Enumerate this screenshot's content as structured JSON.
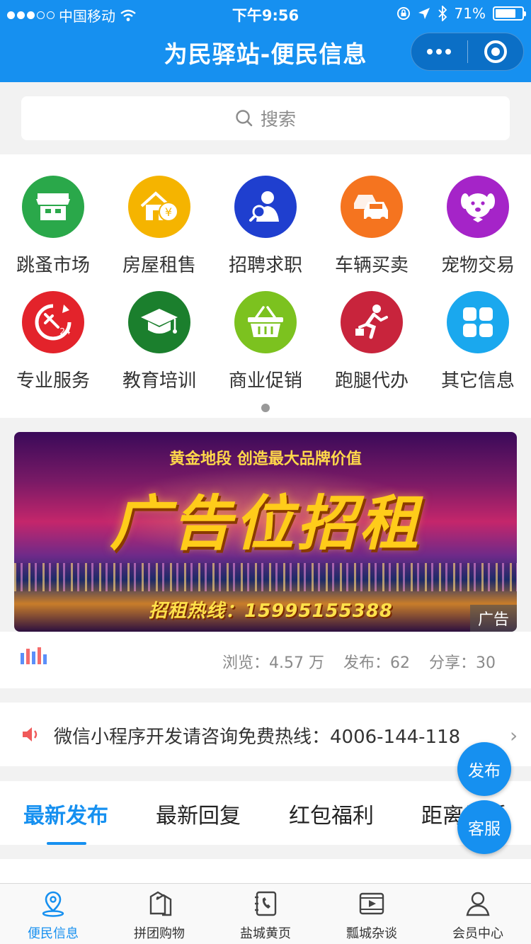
{
  "status_bar": {
    "carrier": "中国移动",
    "time": "下午9:56",
    "battery_percent": "71%",
    "battery_level": 0.71,
    "signal_dots_filled": 3,
    "signal_dots_total": 5
  },
  "header": {
    "title": "为民驿站-便民信息",
    "color": "#1690f0"
  },
  "search": {
    "placeholder": "搜索"
  },
  "categories": [
    {
      "label": "跳蚤市场",
      "color": "#2aa84a",
      "icon": "market-stall-icon"
    },
    {
      "label": "房屋租售",
      "color": "#f5b400",
      "icon": "house-price-icon"
    },
    {
      "label": "招聘求职",
      "color": "#1f3fcf",
      "icon": "job-search-icon"
    },
    {
      "label": "车辆买卖",
      "color": "#f5741f",
      "icon": "cars-icon"
    },
    {
      "label": "宠物交易",
      "color": "#a524c8",
      "icon": "dog-icon"
    },
    {
      "label": "专业服务",
      "color": "#e3232b",
      "icon": "service-24-icon"
    },
    {
      "label": "教育培训",
      "color": "#1b7f2d",
      "icon": "graduation-cap-icon"
    },
    {
      "label": "商业促销",
      "color": "#7cc21f",
      "icon": "shopping-basket-icon"
    },
    {
      "label": "跑腿代办",
      "color": "#c8243c",
      "icon": "runner-icon"
    },
    {
      "label": "其它信息",
      "color": "#1aa8ee",
      "icon": "grid-squares-icon"
    }
  ],
  "banner": {
    "line1": "黄金地段  创造最大品牌价值",
    "headline": "广告位招租",
    "hotline": "招租热线：15995155388",
    "ad_tag": "广告"
  },
  "stats": {
    "views": "浏览：4.57 万",
    "posts": "发布：62",
    "shares": "分享：30"
  },
  "notice": {
    "text": "微信小程序开发请咨询免费热线：4006-144-118"
  },
  "tabs": [
    {
      "label": "最新发布",
      "active": true
    },
    {
      "label": "最新回复",
      "active": false
    },
    {
      "label": "红包福利",
      "active": false
    },
    {
      "label": "距离最近",
      "active": false
    }
  ],
  "floating": {
    "publish": "发布",
    "service": "客服"
  },
  "bottom_nav": [
    {
      "label": "便民信息",
      "icon": "location-pin-icon",
      "active": true
    },
    {
      "label": "拼团购物",
      "icon": "price-tags-icon",
      "active": false
    },
    {
      "label": "盐城黄页",
      "icon": "phone-book-icon",
      "active": false
    },
    {
      "label": "瓢城杂谈",
      "icon": "video-play-icon",
      "active": false
    },
    {
      "label": "会员中心",
      "icon": "person-icon",
      "active": false
    }
  ]
}
